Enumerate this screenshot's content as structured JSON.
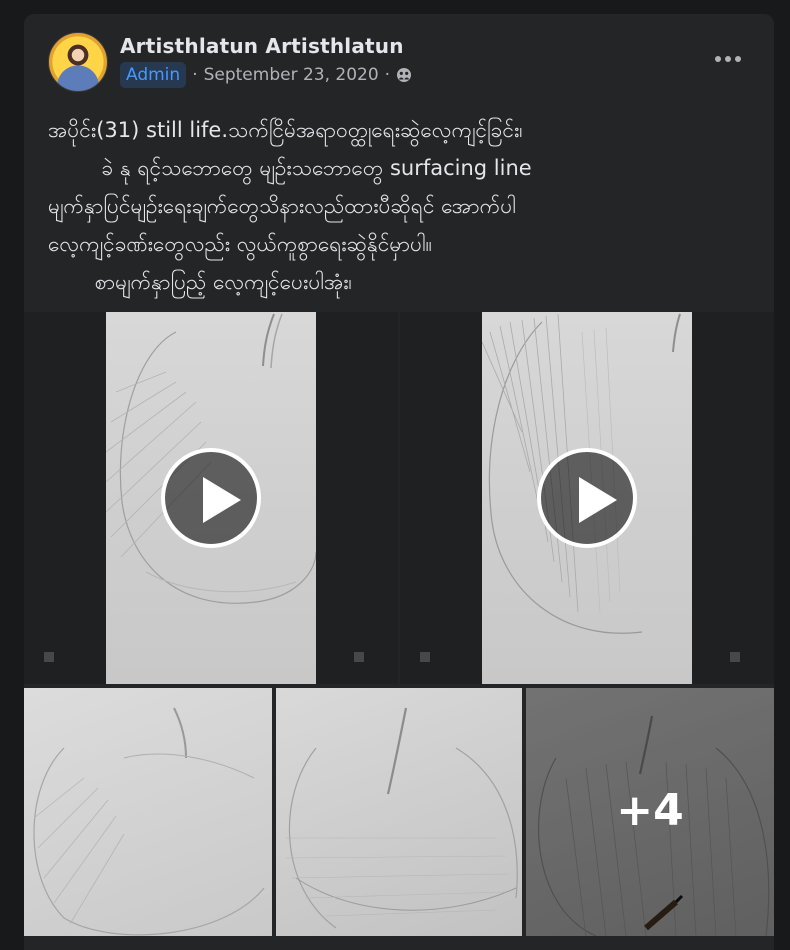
{
  "post": {
    "author": "Artisthlatun Artisthlatun",
    "role_badge": "Admin",
    "separator": "·",
    "date": "September 23, 2020",
    "audience_icon": "group-icon",
    "more_icon": "more-options-icon",
    "text_lines": [
      "အပိုင်း(31) still life.သက်ငြိမ်အရာဝတ္ထုရေးဆွဲလေ့ကျင့်ခြင်း၊",
      "        ခဲ နု ရင့်သဘောတွေ မျဉ်းသဘောတွေ surfacing line",
      "မျက်နှာပြင်မျဉ်းရေးချက်တွေသိနားလည်ထားပီဆိုရင် အောက်ပါ",
      "လေ့ကျင့်ခဏ်းတွေလည်း လွယ်ကူစွာရေးဆွဲနိုင်မှာပါ။",
      "       စာမျက်နှာပြည့် လေ့ကျင့်ပေးပါအုံး၊"
    ]
  },
  "media": {
    "videos": [
      {
        "play_icon": "play-icon"
      },
      {
        "play_icon": "play-icon"
      }
    ],
    "photos": [
      {},
      {},
      {
        "more_count": "+4"
      }
    ]
  },
  "colors": {
    "background": "#18191a",
    "card": "#242526",
    "text_primary": "#e4e6eb",
    "text_secondary": "#b0b3b8",
    "admin_badge_bg": "#263951",
    "admin_badge_text": "#4599ff"
  }
}
